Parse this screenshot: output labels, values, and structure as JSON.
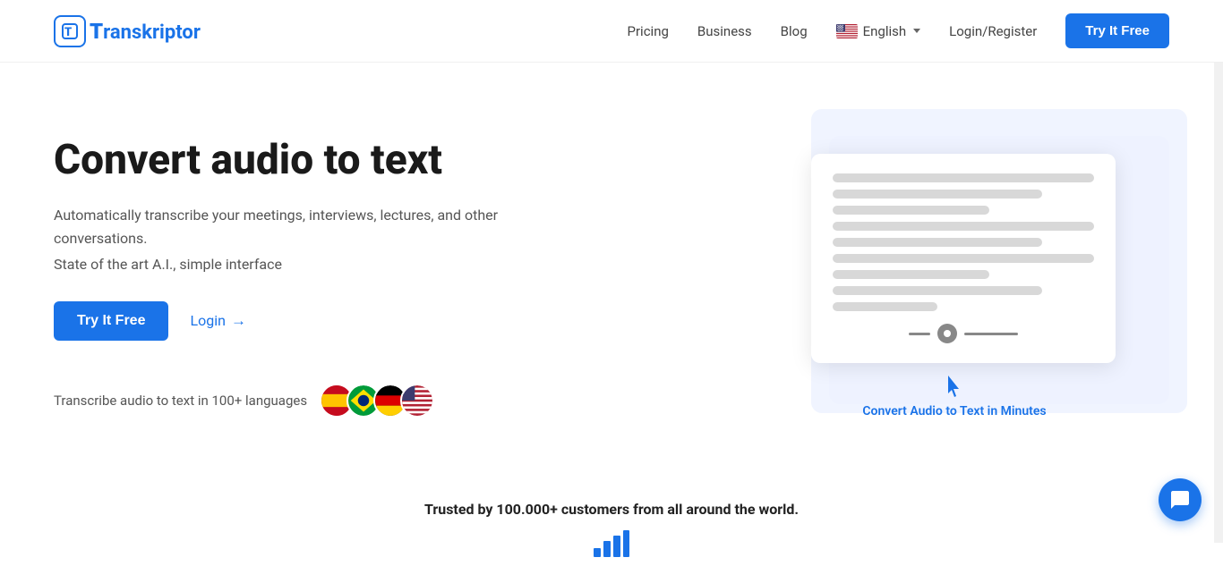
{
  "header": {
    "logo_text": "ranskriptor",
    "logo_letter": "T",
    "nav": {
      "pricing": "Pricing",
      "business": "Business",
      "blog": "Blog",
      "language": "English",
      "login_register": "Login/Register",
      "try_btn": "Try It Free"
    }
  },
  "hero": {
    "title": "Convert audio to text",
    "desc1": "Automatically transcribe your meetings, interviews, lectures, and other conversations.",
    "desc2": "State of the art A.I., simple interface",
    "try_btn": "Try It Free",
    "login_label": "Login",
    "languages_text": "Transcribe audio to text in 100+ languages",
    "flags": [
      "🇪🇸",
      "🇧🇷",
      "🇩🇪",
      "🇺🇸"
    ]
  },
  "illustration": {
    "convert_label": "Convert Audio to Text in Minutes"
  },
  "trusted": {
    "text": "Trusted by 100.000+ customers from all around the world."
  },
  "chat": {
    "icon": "💬"
  }
}
